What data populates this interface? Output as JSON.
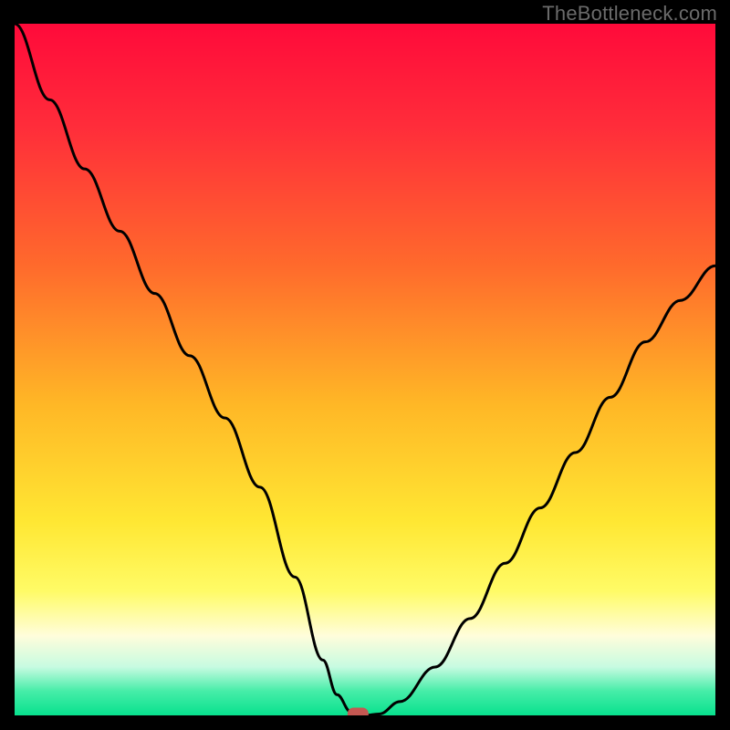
{
  "watermark": "TheBottleneck.com",
  "colors": {
    "frame": "#000000",
    "gradient_stops": [
      {
        "offset": 0.0,
        "color": "#ff0a3a"
      },
      {
        "offset": 0.15,
        "color": "#ff2d3a"
      },
      {
        "offset": 0.35,
        "color": "#ff6a2c"
      },
      {
        "offset": 0.55,
        "color": "#ffb726"
      },
      {
        "offset": 0.72,
        "color": "#ffe733"
      },
      {
        "offset": 0.82,
        "color": "#fffb66"
      },
      {
        "offset": 0.885,
        "color": "#fffddb"
      },
      {
        "offset": 0.93,
        "color": "#c7fbe1"
      },
      {
        "offset": 0.965,
        "color": "#46eda8"
      },
      {
        "offset": 1.0,
        "color": "#08e18e"
      }
    ],
    "curve": "#000000",
    "marker_fill": "#c45852",
    "marker_stroke": "#c45852"
  },
  "chart_data": {
    "type": "line",
    "title": "",
    "xlabel": "",
    "ylabel": "",
    "xlim": [
      0,
      100
    ],
    "ylim": [
      0,
      100
    ],
    "grid": false,
    "marker": {
      "x": 49,
      "y": 0,
      "shape": "rounded"
    },
    "series": [
      {
        "name": "bottleneck-curve",
        "x": [
          0,
          5,
          10,
          15,
          20,
          25,
          30,
          35,
          40,
          44,
          46,
          48,
          49,
          50,
          52,
          55,
          60,
          65,
          70,
          75,
          80,
          85,
          90,
          95,
          100
        ],
        "y": [
          100,
          89,
          79,
          70,
          61,
          52,
          43,
          33,
          20,
          8,
          3,
          0.5,
          0,
          0,
          0.2,
          2,
          7,
          14,
          22,
          30,
          38,
          46,
          54,
          60,
          65
        ]
      }
    ]
  }
}
